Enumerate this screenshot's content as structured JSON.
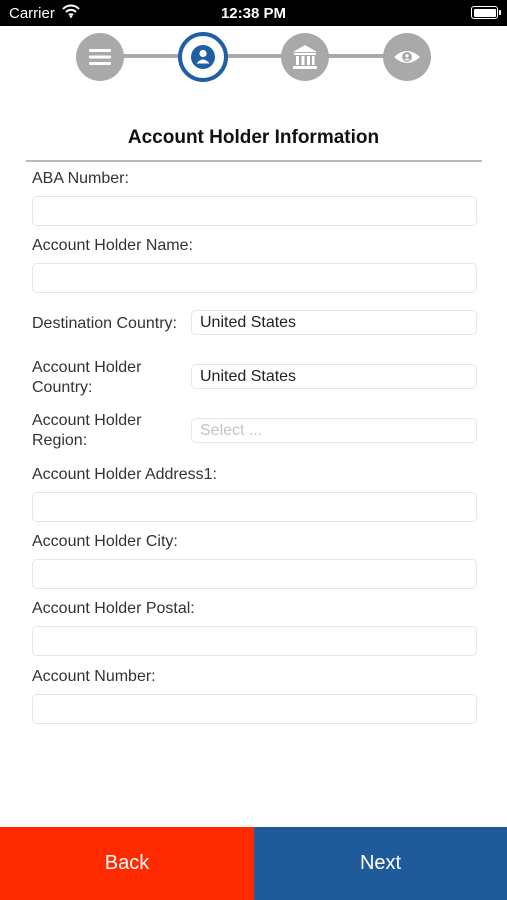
{
  "status_bar": {
    "carrier": "Carrier",
    "time": "12:38 PM",
    "wifi_icon": "wifi-icon",
    "battery_icon": "battery-icon",
    "battery_level": 1.0
  },
  "stepper": {
    "steps": [
      {
        "icon": "menu-lines-icon",
        "state": "inactive"
      },
      {
        "icon": "user-icon",
        "state": "active"
      },
      {
        "icon": "bank-icon",
        "state": "inactive"
      },
      {
        "icon": "eye-icon",
        "state": "inactive"
      }
    ],
    "active_color": "#1f5fa6",
    "inactive_color": "#a9a9a9"
  },
  "form": {
    "title": "Account Holder Information",
    "aba_number": {
      "label": "ABA Number:",
      "value": ""
    },
    "holder_name": {
      "label": "Account Holder Name:",
      "value": ""
    },
    "destination_country": {
      "label": "Destination Country:",
      "value": "United States"
    },
    "holder_country": {
      "label_line1": "Account Holder",
      "label_line2": "Country:",
      "value": "United States"
    },
    "holder_region": {
      "label_line1": "Account Holder",
      "label_line2": "Region:",
      "placeholder": "Select ..."
    },
    "address1": {
      "label": "Account Holder Address1:",
      "value": ""
    },
    "city": {
      "label": "Account Holder City:",
      "value": ""
    },
    "postal": {
      "label": "Account Holder Postal:",
      "value": ""
    },
    "account_number": {
      "label": "Account Number:",
      "value": ""
    }
  },
  "actions": {
    "back_label": "Back",
    "next_label": "Next",
    "back_color": "#ff2a00",
    "next_color": "#1f5a9a"
  }
}
